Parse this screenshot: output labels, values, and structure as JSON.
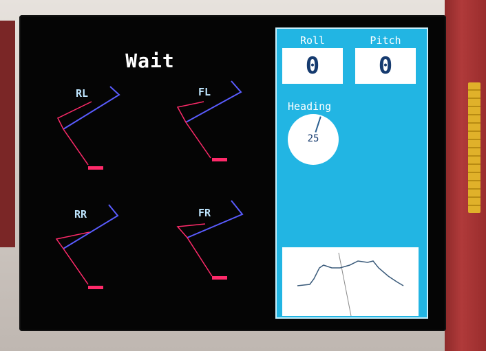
{
  "status": "Wait",
  "legs": [
    {
      "label": "RL"
    },
    {
      "label": "FL"
    },
    {
      "label": "RR"
    },
    {
      "label": "FR"
    }
  ],
  "roll": {
    "label": "Roll",
    "value": "0"
  },
  "pitch": {
    "label": "Pitch",
    "value": "0"
  },
  "heading": {
    "label": "Heading",
    "value": "25"
  },
  "colors": {
    "screen_bg": "#050505",
    "panel_bg": "#22b5e3",
    "leg_upper": "#5a5cff",
    "leg_lower": "#ff2a6a",
    "foot": "#ff2a6a"
  }
}
